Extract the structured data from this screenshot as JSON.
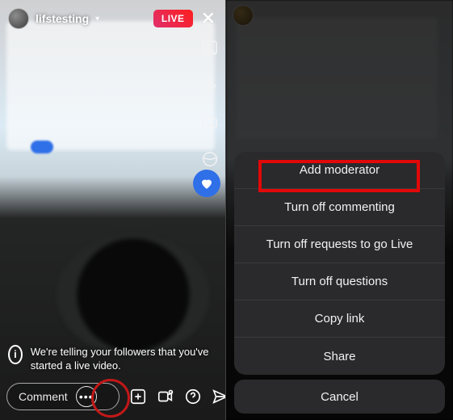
{
  "left": {
    "username": "lifstesting",
    "live_badge": "LIVE",
    "comment_placeholder": "Comment",
    "notice_text": "We're telling your followers that you've started a live video."
  },
  "right": {
    "sheet": [
      "Add moderator",
      "Turn off commenting",
      "Turn off requests to go Live",
      "Turn off questions",
      "Copy link",
      "Share"
    ],
    "cancel": "Cancel"
  },
  "highlight": {
    "left_target": "more-options",
    "right_target_index": 0
  }
}
